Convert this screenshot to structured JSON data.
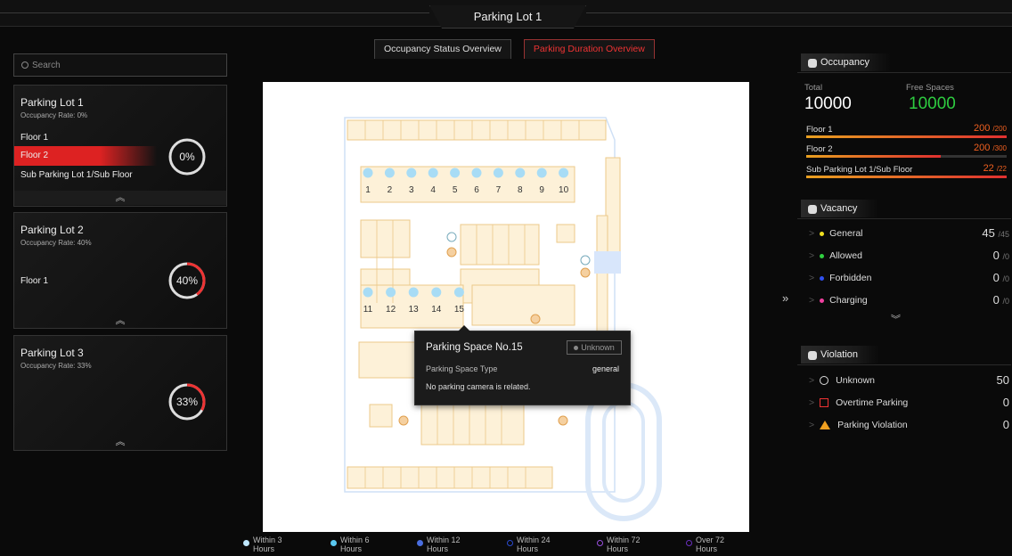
{
  "header": {
    "title": "Parking Lot 1"
  },
  "tabs": [
    {
      "label": "Occupancy Status Overview",
      "active": false
    },
    {
      "label": "Parking Duration Overview",
      "active": true
    }
  ],
  "search": {
    "placeholder": "Search"
  },
  "lots": [
    {
      "name": "Parking Lot 1",
      "rate": "Occupancy Rate: 0%",
      "percent_label": "0%",
      "percent": 0,
      "floors": [
        {
          "label": "Floor 1"
        },
        {
          "label": "Floor 2",
          "selected": true
        },
        {
          "label": "Sub Parking Lot 1/Sub Floor"
        }
      ]
    },
    {
      "name": "Parking Lot 2",
      "rate": "Occupancy Rate: 40%",
      "percent_label": "40%",
      "percent": 40,
      "floors": [
        {
          "label": "Floor 1"
        }
      ]
    },
    {
      "name": "Parking Lot 3",
      "rate": "Occupancy Rate: 33%",
      "percent_label": "33%",
      "percent": 33,
      "floors": []
    }
  ],
  "map": {
    "spaces_row1": [
      "1",
      "2",
      "3",
      "4",
      "5",
      "6",
      "7",
      "8",
      "9",
      "10"
    ],
    "spaces_row2": [
      "11",
      "12",
      "13",
      "14",
      "15"
    ],
    "tooltip": {
      "title": "Parking Space No.15",
      "status": "Unknown",
      "type_label": "Parking Space Type",
      "type_value": "general",
      "note": "No parking camera is related."
    }
  },
  "legend": [
    {
      "label": "Within 3 Hours",
      "color": "#bfe8ff"
    },
    {
      "label": "Within 6 Hours",
      "color": "#5ac8f0"
    },
    {
      "label": "Within 12 Hours",
      "color": "#4a6ee0"
    },
    {
      "label": "Within 24 Hours",
      "color": "#2a4ad0"
    },
    {
      "label": "Within 72 Hours",
      "color": "#9a50e0"
    },
    {
      "label": "Over 72 Hours",
      "color": "#6a30c0"
    }
  ],
  "occupancy": {
    "title": "Occupancy",
    "total_label": "Total",
    "total": "10000",
    "free_label": "Free Spaces",
    "free": "10000",
    "floors": [
      {
        "label": "Floor 1",
        "value": "200",
        "max": "/200",
        "fill": 1.0
      },
      {
        "label": "Floor 2",
        "value": "200",
        "max": "/300",
        "fill": 0.67
      },
      {
        "label": "Sub Parking Lot 1/Sub Floor",
        "value": "22",
        "max": "/22",
        "fill": 1.0
      }
    ]
  },
  "vacancy": {
    "title": "Vacancy",
    "items": [
      {
        "label": "General",
        "value": "45",
        "max": "/45",
        "color": "#f0e020"
      },
      {
        "label": "Allowed",
        "value": "0",
        "max": "/0",
        "color": "#30d040"
      },
      {
        "label": "Forbidden",
        "value": "0",
        "max": "/0",
        "color": "#3050f0"
      },
      {
        "label": "Charging",
        "value": "0",
        "max": "/0",
        "color": "#f040a0"
      }
    ]
  },
  "violation": {
    "title": "Violation",
    "items": [
      {
        "label": "Unknown",
        "value": "50",
        "icon": "question-icon"
      },
      {
        "label": "Overtime Parking",
        "value": "0",
        "icon": "overtime-icon"
      },
      {
        "label": "Parking Violation",
        "value": "0",
        "icon": "warning-icon"
      }
    ]
  }
}
